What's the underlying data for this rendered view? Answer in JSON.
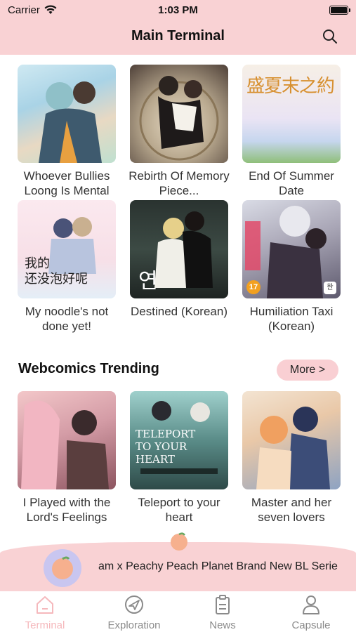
{
  "status_bar": {
    "carrier": "Carrier",
    "time": "1:03 PM"
  },
  "header": {
    "title": "Main Terminal"
  },
  "grid": [
    {
      "title": "Whoever Bullies Loong Is Mental"
    },
    {
      "title": "Rebirth Of Memory Piece..."
    },
    {
      "title": "End Of Summer Date",
      "cover_text": "盛夏末之約"
    },
    {
      "title": "My noodle's not done yet!",
      "cover_text": "我的\n还没泡好呢"
    },
    {
      "title": "Destined (Korean)",
      "cover_text": "연"
    },
    {
      "title": "Humiliation Taxi (Korean)",
      "badge": "17",
      "corner": "한"
    }
  ],
  "trending": {
    "section_title": "Webcomics Trending",
    "more_label": "More >",
    "items": [
      {
        "title": "I Played with the Lord's Feelings"
      },
      {
        "title": "Teleport to your heart",
        "cover_text": "TELEPORT TO YOUR HEART"
      },
      {
        "title": "Master and her seven lovers"
      }
    ]
  },
  "banner": {
    "text": "am x Peachy Peach Planet Brand New BL Serie"
  },
  "tabs": [
    {
      "label": "Terminal",
      "icon": "home-icon",
      "active": true
    },
    {
      "label": "Exploration",
      "icon": "compass-plane-icon",
      "active": false
    },
    {
      "label": "News",
      "icon": "clipboard-icon",
      "active": false
    },
    {
      "label": "Capsule",
      "icon": "person-icon",
      "active": false
    }
  ],
  "colors": {
    "header_bg": "#f9d2d4",
    "accent_pink": "#f5b8bc",
    "more_bg": "#f9cfd3"
  }
}
